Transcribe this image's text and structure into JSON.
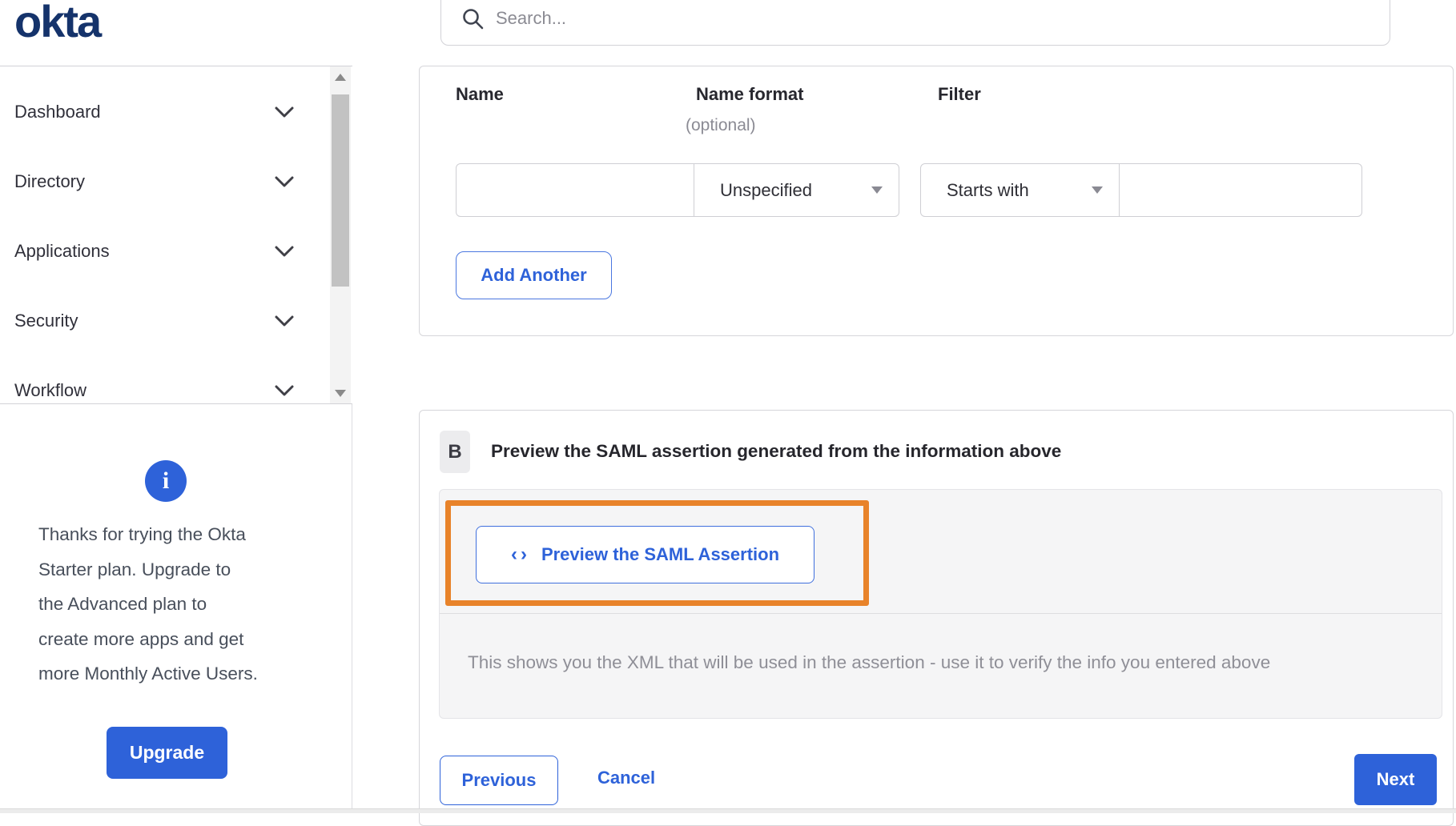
{
  "brand": {
    "logo_text": "okta"
  },
  "header": {
    "search_placeholder": "Search..."
  },
  "sidebar": {
    "items": [
      {
        "label": "Dashboard"
      },
      {
        "label": "Directory"
      },
      {
        "label": "Applications"
      },
      {
        "label": "Security"
      },
      {
        "label": "Workflow"
      }
    ],
    "upgrade": {
      "info_icon": "i",
      "message_lines": [
        "Thanks for trying the Okta",
        "Starter plan. Upgrade to",
        "the Advanced plan to",
        "create more apps and get",
        "more Monthly Active Users."
      ],
      "button_label": "Upgrade"
    }
  },
  "attribute_form": {
    "columns": [
      {
        "label": "Name"
      },
      {
        "label": "Name format",
        "note": "(optional)"
      },
      {
        "label": "Filter"
      }
    ],
    "row": {
      "name_value": "",
      "name_format_selected": "Unspecified",
      "filter_op_selected": "Starts with",
      "filter_value": ""
    },
    "add_button_label": "Add Another"
  },
  "preview_section": {
    "step_badge": "B",
    "title": "Preview the SAML assertion generated from the information above",
    "code_icon": "‹›",
    "preview_button_label": "Preview the SAML Assertion",
    "helper_text": "This shows you the XML that will be used in the assertion - use it to verify the info you entered above"
  },
  "footer": {
    "previous_label": "Previous",
    "cancel_label": "Cancel",
    "next_label": "Next"
  },
  "colors": {
    "accent_blue": "#2e62d9",
    "logo_navy": "#15336b",
    "annotation_orange": "#e8832a",
    "panel_gray": "#f5f5f6",
    "muted_text": "#8f8f97"
  }
}
